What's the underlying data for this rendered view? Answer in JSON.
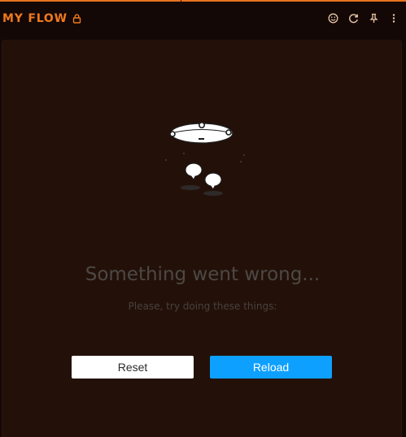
{
  "header": {
    "title": "MY FLOW",
    "title_icon": "lock-icon",
    "actions": [
      {
        "name": "smiley-icon"
      },
      {
        "name": "refresh-icon"
      },
      {
        "name": "pin-icon"
      },
      {
        "name": "more-vertical-icon"
      }
    ]
  },
  "error": {
    "illustration": "ufo-chat-bubbles-illustration",
    "title": "Something went wrong...",
    "subtitle": "Please, try doing these things:"
  },
  "buttons": {
    "reset_label": "Reset",
    "reload_label": "Reload"
  },
  "colors": {
    "accent": "#f07a1d",
    "background": "#140806",
    "panel": "#231109",
    "reload_button": "#0ea0ff"
  }
}
